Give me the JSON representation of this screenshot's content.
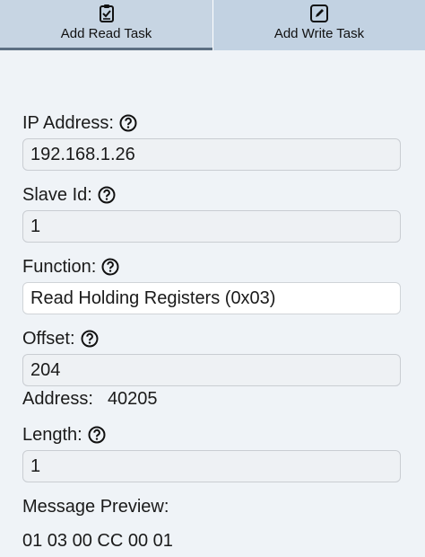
{
  "tabs": {
    "read": {
      "label": "Add Read Task",
      "icon": "clipboard-check-icon"
    },
    "write": {
      "label": "Add Write Task",
      "icon": "edit-square-icon"
    }
  },
  "form": {
    "ip": {
      "label": "IP Address:",
      "value": "192.168.1.26"
    },
    "slave": {
      "label": "Slave Id:",
      "value": "1"
    },
    "function": {
      "label": "Function:",
      "value": "Read Holding Registers (0x03)"
    },
    "offset": {
      "label": "Offset:",
      "value": "204"
    },
    "address": {
      "label": "Address:",
      "value": "40205"
    },
    "length": {
      "label": "Length:",
      "value": "1"
    },
    "preview": {
      "label": "Message Preview:",
      "value": "01 03 00 CC 00 01"
    }
  },
  "colors": {
    "background": "#eff3f7",
    "tab_bg": "#c7d5e3",
    "tab_indicator": "#5c6f82"
  }
}
